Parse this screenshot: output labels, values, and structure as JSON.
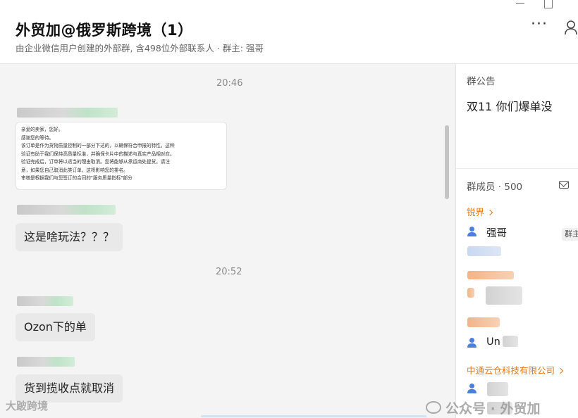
{
  "header": {
    "title": "外贸加@俄罗斯跨境（1）",
    "subtitle": "由企业微信用户创建的外部群, 含498位外部联系人 · 群主: 强哥",
    "more_label": "···"
  },
  "chat": {
    "messages": [
      {
        "time": "20:46"
      },
      {
        "doc_lines": [
          "亲爱的卖家，您好。",
          "感谢您的等待。",
          "该订单是作为货物质量控制的一部分下达的，以确保符合申报的特性。这种",
          "验证有助于我们保持高质量标准，并确保卡片中的描述与真实产品相对应。",
          "验证完成后，订单将以适当的理由取消。您将能够从承运商处提货。请注",
          "意，如果您自己取消此类订单，这将影响您的排名。",
          "审核是根据我们与您签订的合同的\"服务质量指标\"部分"
        ]
      },
      {
        "text": "这是啥玩法？？？"
      },
      {
        "time": "20:52"
      },
      {
        "text": "Ozon下的单"
      },
      {
        "text": "货到揽收点就取消"
      }
    ]
  },
  "panel": {
    "notice_title": "群公告",
    "notice_text": "双11 你们爆单没",
    "members_title": "群成员 · 500",
    "org_1": "锐界",
    "member_owner": "强哥",
    "owner_badge": "群主",
    "member_2_name": "Un  k",
    "org_last": "中通云仓科技有限公司"
  },
  "watermark": {
    "left": "大跛跨境",
    "right": "公众号 · 外贸加"
  },
  "colors": {
    "accent_orange": "#e37a1a",
    "user_icon_blue": "#4a7fe0",
    "bubble_gray": "#e9e9ea"
  }
}
